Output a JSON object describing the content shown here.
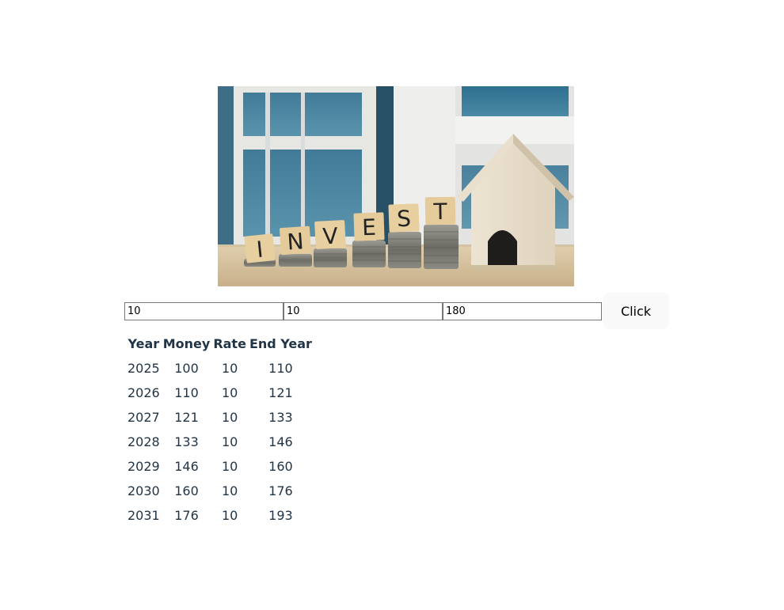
{
  "hero": {
    "alt": "Invest coins and house image",
    "letters": [
      "I",
      "N",
      "V",
      "E",
      "S",
      "T"
    ]
  },
  "form": {
    "inputs": [
      {
        "value": "10"
      },
      {
        "value": "10"
      },
      {
        "value": "180"
      }
    ],
    "button_label": "Click"
  },
  "table": {
    "headers": [
      "Year",
      "Money",
      "Rate",
      "End Year"
    ],
    "rows": [
      [
        "2025",
        "100",
        "10",
        "110"
      ],
      [
        "2026",
        "110",
        "10",
        "121"
      ],
      [
        "2027",
        "121",
        "10",
        "133"
      ],
      [
        "2028",
        "133",
        "10",
        "146"
      ],
      [
        "2029",
        "146",
        "10",
        "160"
      ],
      [
        "2030",
        "160",
        "10",
        "176"
      ],
      [
        "2031",
        "176",
        "10",
        "193"
      ]
    ]
  }
}
